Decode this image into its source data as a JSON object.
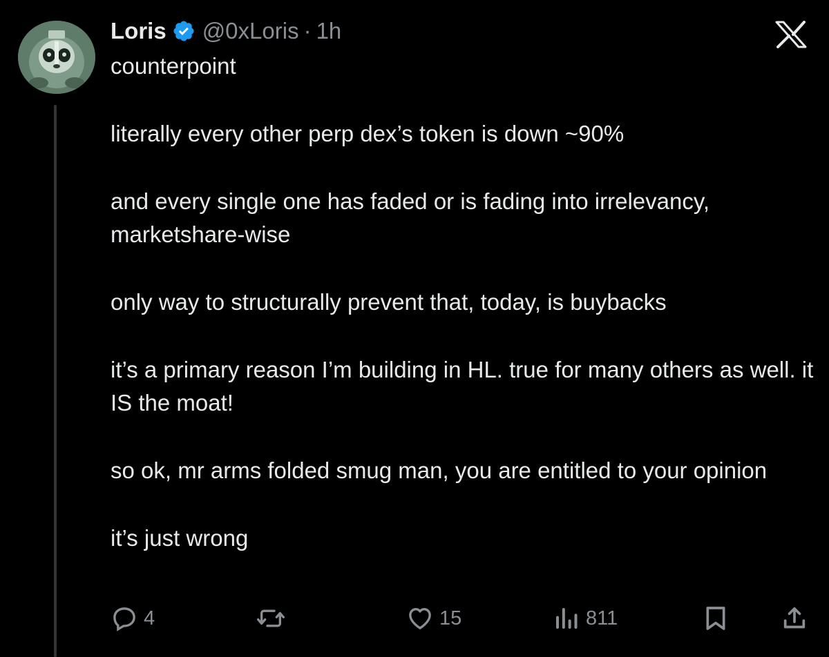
{
  "author": {
    "name": "Loris",
    "handle": "@0xLoris",
    "separator": "·",
    "time": "1h",
    "verified": true,
    "verified_color": "#1d9bf0"
  },
  "tweet": {
    "paragraphs": [
      "counterpoint",
      "literally every other perp dex’s token is down ~90%",
      "and every single one has faded or is fading into irrelevancy, marketshare-wise",
      "only way to structurally prevent that, today, is buybacks",
      "it’s a primary reason I’m building in HL. true for many others as well. it IS the moat!",
      "so ok, mr arms folded smug man, you are entitled to your opinion",
      "it’s just wrong"
    ]
  },
  "actions": {
    "replies": "4",
    "reposts": "",
    "likes": "15",
    "views": "811"
  },
  "icons": {
    "brand": "x-logo-icon",
    "reply": "reply-icon",
    "repost": "repost-icon",
    "like": "heart-icon",
    "views": "views-icon",
    "bookmark": "bookmark-icon",
    "share": "share-icon"
  },
  "colors": {
    "background": "#000000",
    "text": "#e7e9ea",
    "muted": "#8b8f94"
  }
}
